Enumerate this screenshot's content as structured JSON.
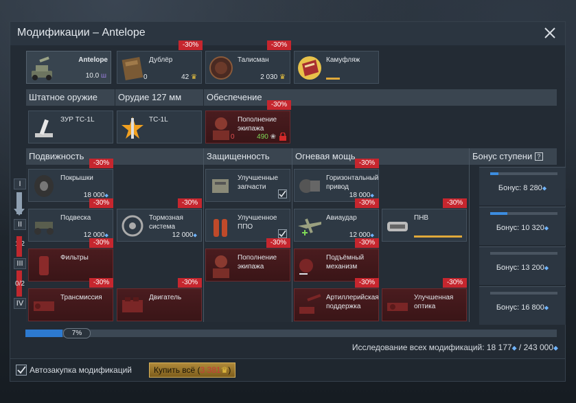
{
  "window": {
    "title": "Модификации – Antelope"
  },
  "top_row": [
    {
      "name": "Antelope",
      "value": "10.0",
      "value_suffix": "ш"
    },
    {
      "name": "Дублёр",
      "left_count": "0",
      "price": "42",
      "badge": "-30%"
    },
    {
      "name": "Талисман",
      "price": "2 030",
      "badge": "-30%"
    },
    {
      "name": "Камуфляж"
    }
  ],
  "sections": {
    "weapons": "Штатное оружие",
    "cannon": "Орудие 127 мм",
    "support": "Обеспечение",
    "mobility": "Подвижность",
    "protection": "Защищенность",
    "firepower": "Огневая мощь",
    "tier_bonus": "Бонус ступени",
    "help": "?"
  },
  "row2": [
    {
      "name": "ЗУР TC-1L"
    },
    {
      "name": "TC-1L"
    },
    {
      "name": "Пополнение экипажа",
      "left_count": "0",
      "price": "490",
      "badge": "-30%"
    }
  ],
  "mods": {
    "tires": {
      "name": "Покрышки",
      "cost": "18 000",
      "badge": "-30%"
    },
    "suspension": {
      "name": "Подвеска",
      "cost": "12 000",
      "badge": "-30%"
    },
    "brakes": {
      "name": "Тормозная система",
      "cost": "12 000",
      "badge": "-30%"
    },
    "filters": {
      "name": "Фильтры",
      "badge": "-30%"
    },
    "transmission": {
      "name": "Трансмиссия",
      "badge": "-30%"
    },
    "engine": {
      "name": "Двигатель",
      "badge": "-30%"
    },
    "parts": {
      "name": "Улучшенные запчасти"
    },
    "fpe": {
      "name": "Улучшенное ППО"
    },
    "crew": {
      "name": "Пополнение экипажа",
      "badge": "-30%"
    },
    "traverse": {
      "name": "Горизонтальный привод",
      "cost": "18 000",
      "badge": "-30%"
    },
    "airstrike": {
      "name": "Авиаудар",
      "cost": "12 000",
      "badge": "-30%"
    },
    "nvd": {
      "name": "ПНВ",
      "badge": "-30%"
    },
    "elevation": {
      "name": "Подъёмный механизм",
      "badge": "-30%"
    },
    "artillery": {
      "name": "Артиллерийская поддержка",
      "badge": "-30%"
    },
    "optics": {
      "name": "Улучшенная оптика",
      "badge": "-30%"
    }
  },
  "tiers": [
    "I",
    "II",
    "III",
    "IV"
  ],
  "tier_fractions": [
    "1/2",
    "0/2"
  ],
  "bonuses": [
    {
      "label": "Бонус: 8 280",
      "progress": 0.12
    },
    {
      "label": "Бонус: 10 320",
      "progress": 0.25
    },
    {
      "label": "Бонус: 13 200",
      "progress": 0
    },
    {
      "label": "Бонус: 16 800",
      "progress": 0
    }
  ],
  "progress": {
    "percent_label": "7%",
    "value": 0.07
  },
  "research": {
    "text": "Исследование всех модификаций: 18 177",
    "separator": "/",
    "total": "243 000"
  },
  "footer": {
    "autobuy_label": "Автозакупка модификаций",
    "autobuy_checked": true,
    "buy_label": "Купить всё (",
    "buy_price": "3 381",
    "buy_close": ")"
  },
  "colors": {
    "discount": "#c6262e",
    "rp": "#6fb4ff",
    "gold": "#e8c13f",
    "eagles_green": "#7ed957"
  }
}
